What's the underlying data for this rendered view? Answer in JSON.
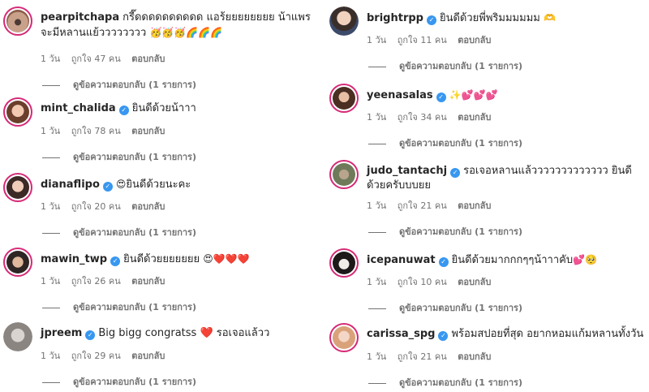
{
  "labels": {
    "likes_prefix": "ถูกใจ",
    "likes_suffix": "คน",
    "reply": "ตอบกลับ",
    "view_replies": "ดูข้อความตอบกลับ (1 รายการ)"
  },
  "left": [
    {
      "user": "pearpitchapa",
      "verified": false,
      "text": "กรี๊ดดดดดดดดดด แอร้ยยยยยยยย น้าแพรจะมีหลานแย้วววววววว",
      "emoji": "🥳🥳🥳🌈🌈🌈",
      "time": "1 วัน",
      "likes": "47"
    },
    {
      "user": "mint_chalida",
      "verified": true,
      "text": "ยินดีด้วยน้าาา",
      "emoji": "",
      "time": "1 วัน",
      "likes": "78"
    },
    {
      "user": "dianaflipo",
      "verified": true,
      "text": "ยินดีด้วยนะคะ",
      "emoji": "😍",
      "time": "1 วัน",
      "likes": "20"
    },
    {
      "user": "mawin_twp",
      "verified": true,
      "text": "ยินดีด้วยยยยยยย",
      "emoji": "😍❤️❤️❤️",
      "time": "1 วัน",
      "likes": "26"
    },
    {
      "user": "jpreem",
      "verified": true,
      "text": "Big bigg congratss ❤️ รอเจอแล้วว",
      "emoji": "",
      "time": "1 วัน",
      "likes": "29"
    }
  ],
  "right": [
    {
      "user": "brightrpp",
      "verified": true,
      "text": "ยินดีด้วยพี่พริมมมมมม",
      "emoji": "🫶",
      "time": "1 วัน",
      "likes": "11"
    },
    {
      "user": "yeenasalas",
      "verified": true,
      "text": "",
      "emoji": "✨💕💕💕",
      "time": "1 วัน",
      "likes": "34"
    },
    {
      "user": "judo_tantachj",
      "verified": true,
      "text": "รอเจอหลานแล้ววววววววววววว ยินดีด้วยครับบบยย",
      "emoji": "",
      "time": "1 วัน",
      "likes": "21"
    },
    {
      "user": "icepanuwat",
      "verified": true,
      "text": "ยินดีด้วยมากกกๆๆน้าาาคับ",
      "emoji": "💕🥺",
      "time": "1 วัน",
      "likes": "10"
    },
    {
      "user": "carissa_spg",
      "verified": true,
      "text": "พร้อมสปอยที่สุด อยากหอมแก้มหลานทั้งวัน",
      "emoji": "",
      "time": "1 วัน",
      "likes": "21"
    }
  ],
  "colors": {
    "verified": "#3897f0",
    "meta": "#737373",
    "story_ring": "#d62976"
  }
}
